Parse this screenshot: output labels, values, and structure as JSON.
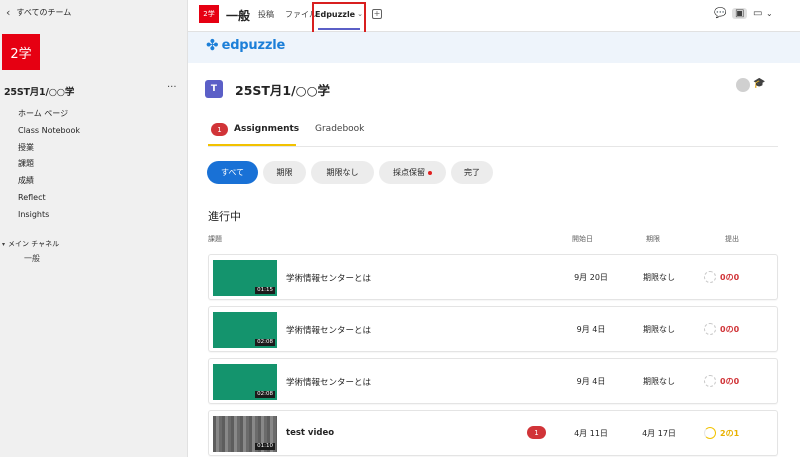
{
  "sidebar": {
    "back_label": "すべてのチーム",
    "team_logo_text": "2学",
    "team_name": "25ST月1/○○学",
    "more_label": "···",
    "nav_items": [
      "ホーム ページ",
      "Class Notebook",
      "授業",
      "課題",
      "成績",
      "Reflect",
      "Insights"
    ],
    "channel_group": "メイン チャネル",
    "channels": [
      "一般"
    ]
  },
  "topbar": {
    "logo_text": "2学",
    "channel_title": "一般",
    "tabs": [
      "投稿",
      "ファイル",
      "Edpuzzle"
    ],
    "add_tab_label": "+",
    "icons": [
      "chat-icon",
      "edpuzzle-app-icon",
      "video-call-icon",
      "dropdown-icon"
    ]
  },
  "edpuzzle": {
    "logo_text": "edpuzzle",
    "class_icon_text": "T",
    "class_title": "25ST月1/○○学",
    "assignments_count": "1",
    "tab_assignments": "Assignments",
    "tab_gradebook": "Gradebook",
    "filters": [
      "すべて",
      "期限",
      "期限なし",
      "採点保留",
      "完了"
    ],
    "section_heading": "進行中",
    "columns": {
      "title": "課題",
      "start": "開始日",
      "due": "期限",
      "submit": "提出"
    },
    "rows": [
      {
        "title": "学術情報センターとは",
        "duration": "01:15",
        "start": "9月 20日",
        "due": "期限なし",
        "submit": "0の0",
        "badge": ""
      },
      {
        "title": "学術情報センターとは",
        "duration": "02:08",
        "start": "9月 4日",
        "due": "期限なし",
        "submit": "0の0",
        "badge": ""
      },
      {
        "title": "学術情報センターとは",
        "duration": "02:08",
        "start": "9月 4日",
        "due": "期限なし",
        "submit": "0の0",
        "badge": ""
      },
      {
        "title": "test video",
        "duration": "01:10",
        "start": "4月 11日",
        "due": "4月 17日",
        "submit": "2の1",
        "badge": "1"
      }
    ]
  },
  "colors": {
    "brand_red": "#e60012",
    "edpuzzle_blue": "#1c7fd8",
    "teams_purple": "#5b5fc7",
    "active_pill": "#1971d6",
    "submit_red": "#d13438",
    "submit_yellow": "#e8b100"
  }
}
